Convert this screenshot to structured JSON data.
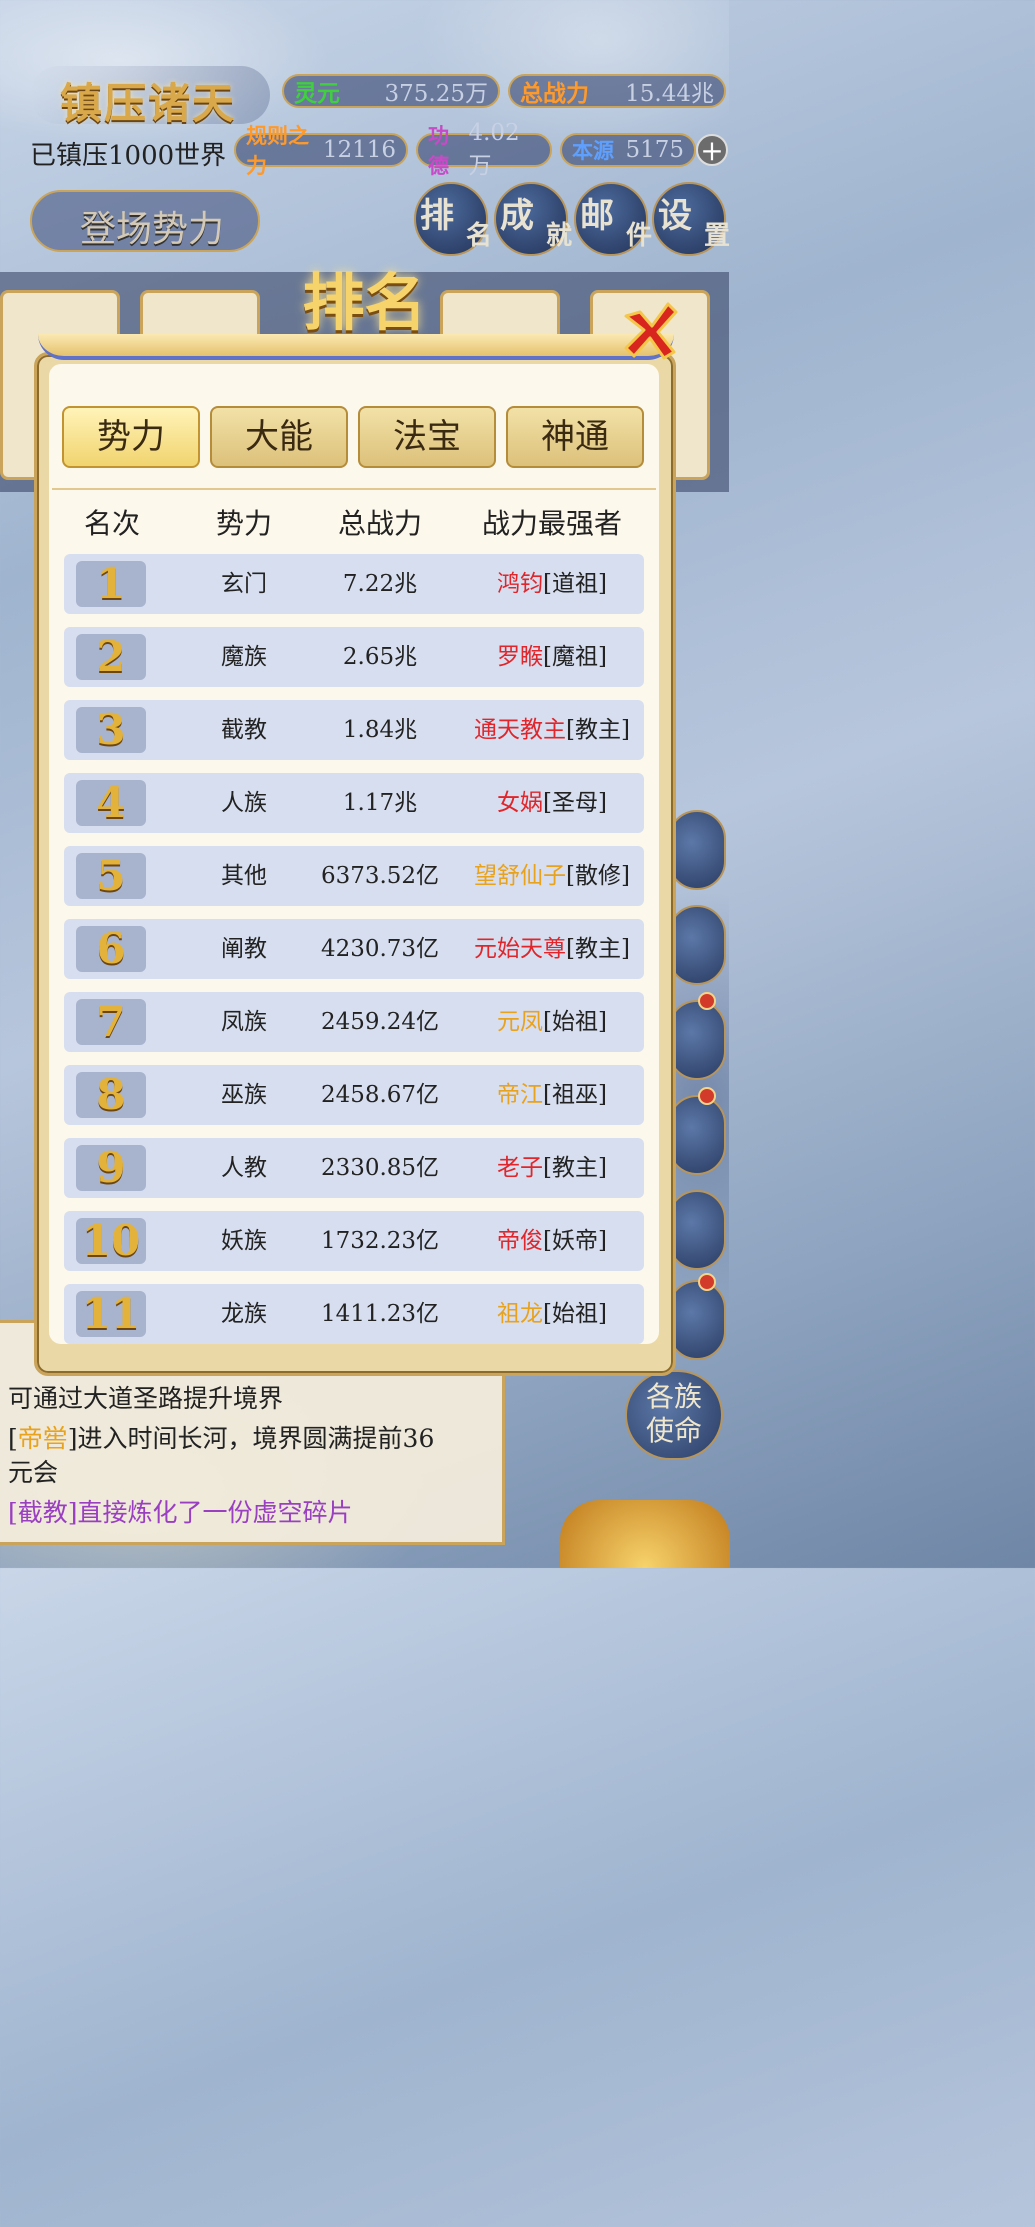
{
  "header": {
    "game_title": "镇压诸天",
    "world_text": "已镇压1000世界",
    "stats": [
      {
        "label": "灵元",
        "value": "375.25万",
        "color": "#3fcf3f"
      },
      {
        "label": "总战力",
        "value": "15.44兆",
        "color": "#ff9a2a"
      },
      {
        "label": "规则之力",
        "value": "12116",
        "color": "#ff9a2a"
      },
      {
        "label": "功德",
        "value": "4.02万",
        "color": "#c64bc6"
      },
      {
        "label": "本源",
        "value": "5175",
        "color": "#5fa0ff"
      }
    ],
    "enter_label": "登场势力",
    "nav": [
      {
        "a": "排",
        "b": "名"
      },
      {
        "a": "成",
        "b": "就"
      },
      {
        "a": "邮",
        "b": "件"
      },
      {
        "a": "设",
        "b": "置"
      }
    ]
  },
  "modal": {
    "title": "排名",
    "tabs": [
      "势力",
      "大能",
      "法宝",
      "神通"
    ],
    "active_tab": "势力",
    "columns": [
      "名次",
      "势力",
      "总战力",
      "战力最强者"
    ],
    "rows": [
      {
        "rank": "1",
        "force": "玄门",
        "power": "7.22兆",
        "leader": "鸿钧",
        "title": "[道祖]",
        "leader_color": "red"
      },
      {
        "rank": "2",
        "force": "魔族",
        "power": "2.65兆",
        "leader": "罗睺",
        "title": "[魔祖]",
        "leader_color": "red"
      },
      {
        "rank": "3",
        "force": "截教",
        "power": "1.84兆",
        "leader": "通天教主",
        "title": "[教主]",
        "leader_color": "red"
      },
      {
        "rank": "4",
        "force": "人族",
        "power": "1.17兆",
        "leader": "女娲",
        "title": "[圣母]",
        "leader_color": "red"
      },
      {
        "rank": "5",
        "force": "其他",
        "power": "6373.52亿",
        "leader": "望舒仙子",
        "title": "[散修]",
        "leader_color": "gold"
      },
      {
        "rank": "6",
        "force": "阐教",
        "power": "4230.73亿",
        "leader": "元始天尊",
        "title": "[教主]",
        "leader_color": "red"
      },
      {
        "rank": "7",
        "force": "凤族",
        "power": "2459.24亿",
        "leader": "元凤",
        "title": "[始祖]",
        "leader_color": "gold"
      },
      {
        "rank": "8",
        "force": "巫族",
        "power": "2458.67亿",
        "leader": "帝江",
        "title": "[祖巫]",
        "leader_color": "gold"
      },
      {
        "rank": "9",
        "force": "人教",
        "power": "2330.85亿",
        "leader": "老子",
        "title": "[教主]",
        "leader_color": "red"
      },
      {
        "rank": "10",
        "force": "妖族",
        "power": "1732.23亿",
        "leader": "帝俊",
        "title": "[妖帝]",
        "leader_color": "red"
      },
      {
        "rank": "11",
        "force": "龙族",
        "power": "1411.23亿",
        "leader": "祖龙",
        "title": "[始祖]",
        "leader_color": "gold"
      }
    ]
  },
  "log": {
    "line1": "可通过大道圣路提升境界",
    "line2_name": "帝喾",
    "line2_text": "]进入时间长河，境界圆满提前36",
    "line3": "元会",
    "line4": "[截教]直接炼化了一份虚空碎片"
  },
  "side": {
    "clan_label_1": "各族",
    "clan_label_2": "使命"
  }
}
